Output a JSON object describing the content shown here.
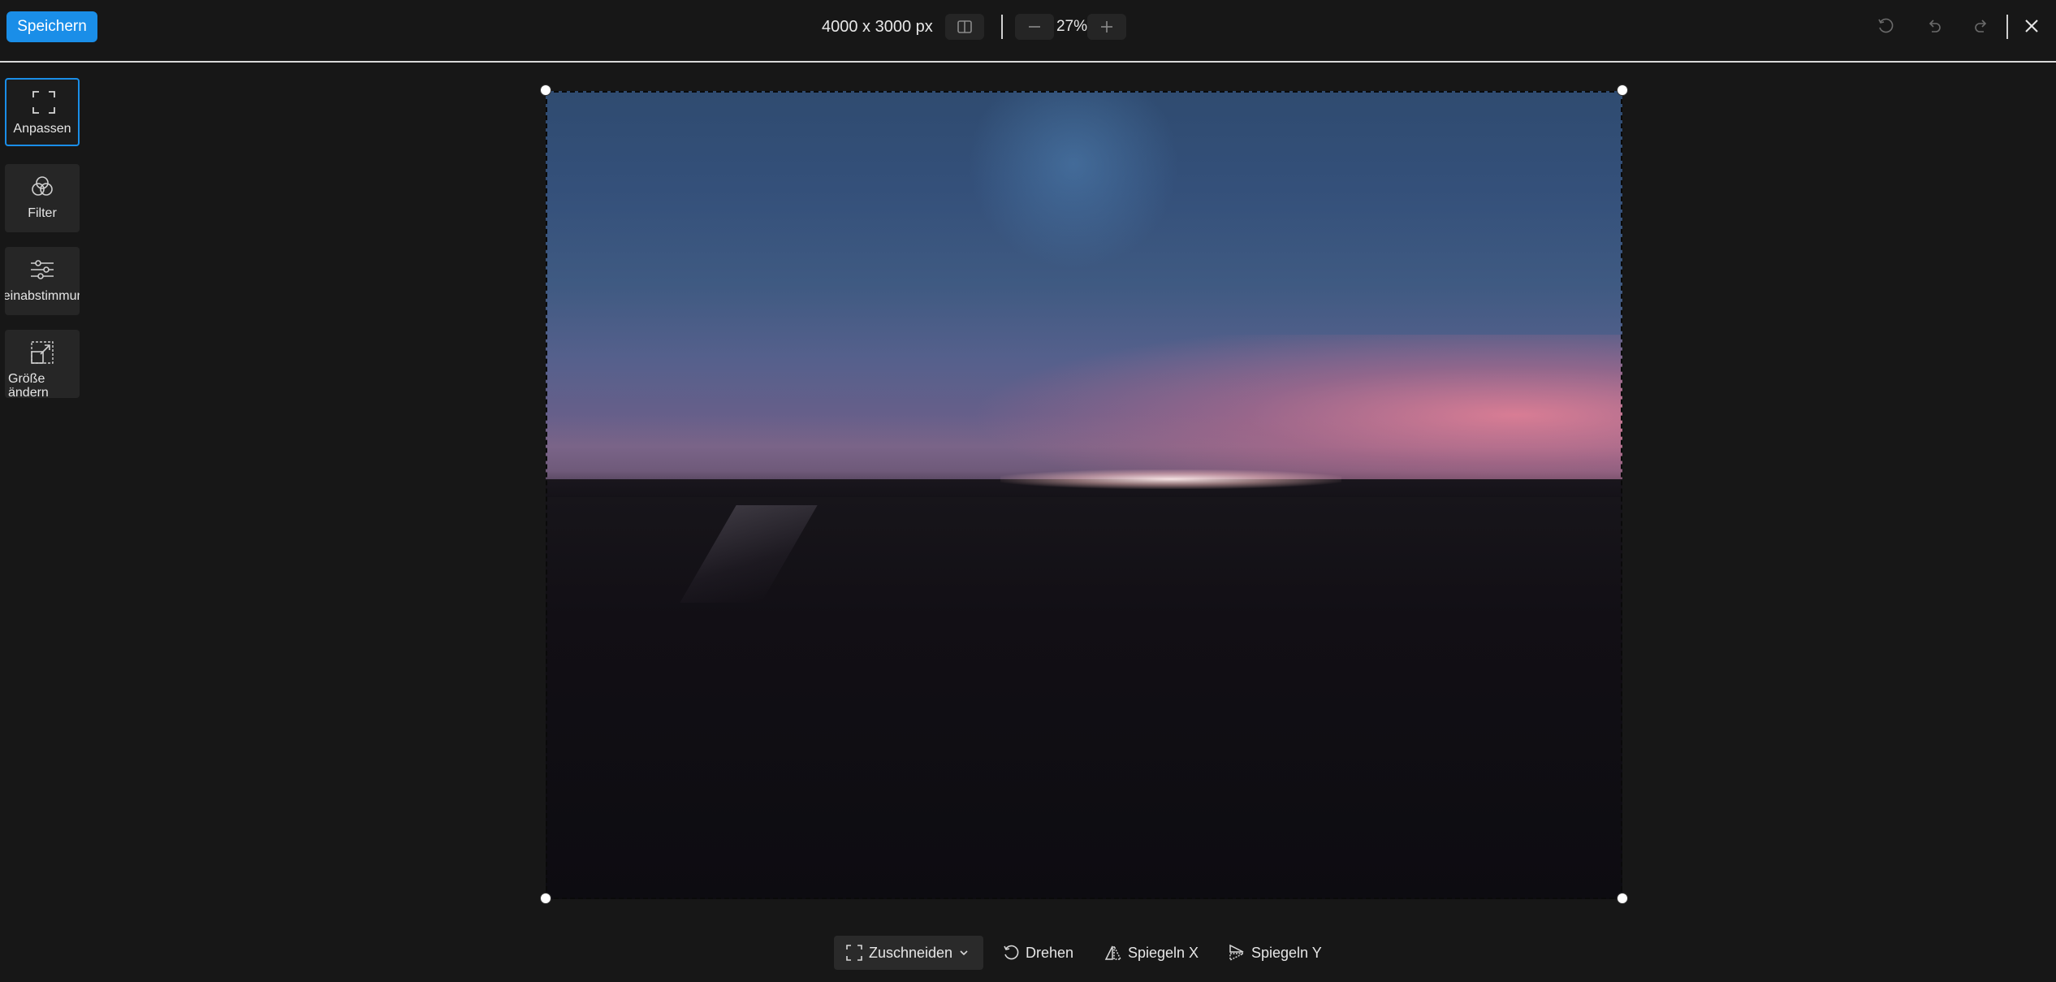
{
  "toolbar": {
    "save_label": "Speichern",
    "dimensions": "4000 x 3000 px",
    "zoom_level": "27%"
  },
  "sidebar": {
    "items": [
      {
        "label": "Anpassen",
        "icon": "crop-frame-icon",
        "active": true
      },
      {
        "label": "Filter",
        "icon": "filter-circles-icon",
        "active": false
      },
      {
        "label": "Feinabstimmung",
        "icon": "sliders-icon",
        "active": false
      },
      {
        "label": "Größe ändern",
        "icon": "resize-icon",
        "active": false
      }
    ]
  },
  "bottom_toolbar": {
    "crop_label": "Zuschneiden",
    "rotate_label": "Drehen",
    "flip_x_label": "Spiegeln X",
    "flip_y_label": "Spiegeln Y"
  },
  "colors": {
    "accent": "#1a8ee8",
    "background": "#171717",
    "panel": "#262626"
  }
}
